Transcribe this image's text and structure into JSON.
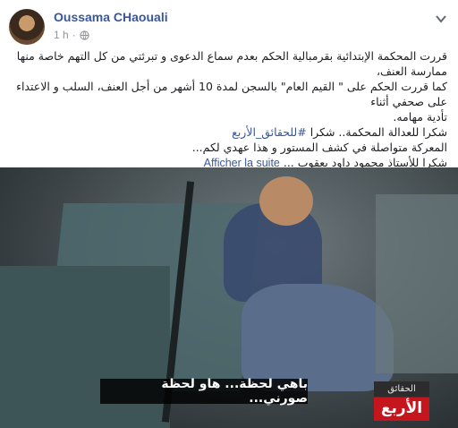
{
  "post": {
    "author": "Oussama CHaouali",
    "time": "1 h",
    "privacy_icon": "globe-icon",
    "options_icon": "chevron-down-icon",
    "lines": [
      "قررت المحكمة الإبتدائية بقرمبالية الحكم بعدم سماع الدعوى و تبرئتي من كل التهم خاصة منها ممارسة العنف،",
      "كما قررت الحكم على \" القيم العام\" بالسجن لمدة 10 أشهر من أجل العنف، السلب و الاعتداء على صحفي أثناء",
      "تأدية مهامه.",
      "شكرا للعدالة المحكمة.. شكرا",
      "#للحقائق_الأربع",
      "المعركة متواصلة في كشف المستور و هذا عهدي لكم...",
      "شكرا للأستاذ محمود داود يعقوب ...",
      "Afficher la suite"
    ]
  },
  "video": {
    "subtitle": "باهي لحظة... هاو لحظة صورني...",
    "logo_line1": "الحقائق",
    "logo_line2": "الأربع",
    "colors": {
      "logo_red": "#c4161c",
      "link": "#385898"
    }
  }
}
